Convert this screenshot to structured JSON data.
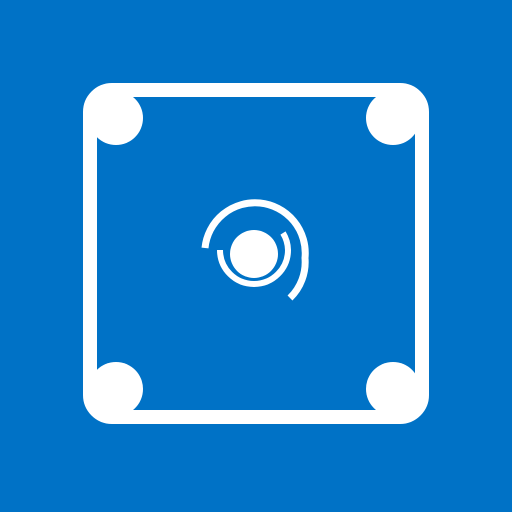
{
  "icon": {
    "name": "billiard-table-icon",
    "background_color": "#0072C6",
    "foreground_color": "#FFFFFF"
  }
}
